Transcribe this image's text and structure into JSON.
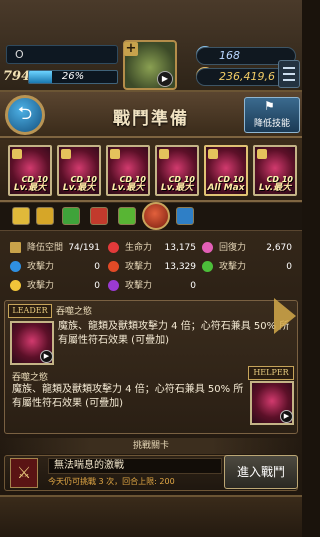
{
  "player": {
    "name": "O",
    "level": "794",
    "exp_percent": "26%",
    "exp_fraction": 0.26
  },
  "currency": {
    "gems": "168",
    "coins": "236,419,6"
  },
  "header": {
    "title": "戰鬥準備",
    "skill_button_label": "降低技能",
    "back_icon": "back-arrow-icon"
  },
  "team": [
    {
      "cd": "CD 10",
      "lv": "Lv.最大"
    },
    {
      "cd": "CD 10",
      "lv": "Lv.最大"
    },
    {
      "cd": "CD 10",
      "lv": "Lv.最大"
    },
    {
      "cd": "CD 10",
      "lv": "Lv.最大"
    },
    {
      "cd": "CD 10",
      "lv": "All Max"
    },
    {
      "cd": "CD 10",
      "lv": "Lv.最大"
    }
  ],
  "stats": {
    "space_label": "降伍空間",
    "space_value": "74/191",
    "hp_label": "生命力",
    "hp_value": "13,175",
    "recover_label": "回復力",
    "recover_value": "2,670",
    "water_atk_label": "攻擊力",
    "water_atk_value": "0",
    "fire_atk_label": "攻擊力",
    "fire_atk_value": "13,329",
    "wood_atk_label": "攻擊力",
    "wood_atk_value": "0",
    "light_atk_label": "攻擊力",
    "light_atk_value": "0",
    "dark_atk_label": "攻擊力",
    "dark_atk_value": "0"
  },
  "leader": {
    "tag": "LEADER",
    "name": "吞噬之慾",
    "desc": "魔族、龍類及獸類攻擊力 4 倍；心符石兼具 50% 所有屬性符石效果 (可疊加)"
  },
  "helper": {
    "tag": "HELPER",
    "name": "吞噬之慾",
    "desc": "魔族、龍類及獸類攻擊力 4 倍；心符石兼具 50% 所有屬性符石效果 (可疊加)"
  },
  "challenge": {
    "title": "挑戰關卡",
    "stage_name": "無法喘息的激戰",
    "note": "今天仍可挑戰 3 次，回合上限: 200",
    "enter_label": "進入戰鬥"
  }
}
